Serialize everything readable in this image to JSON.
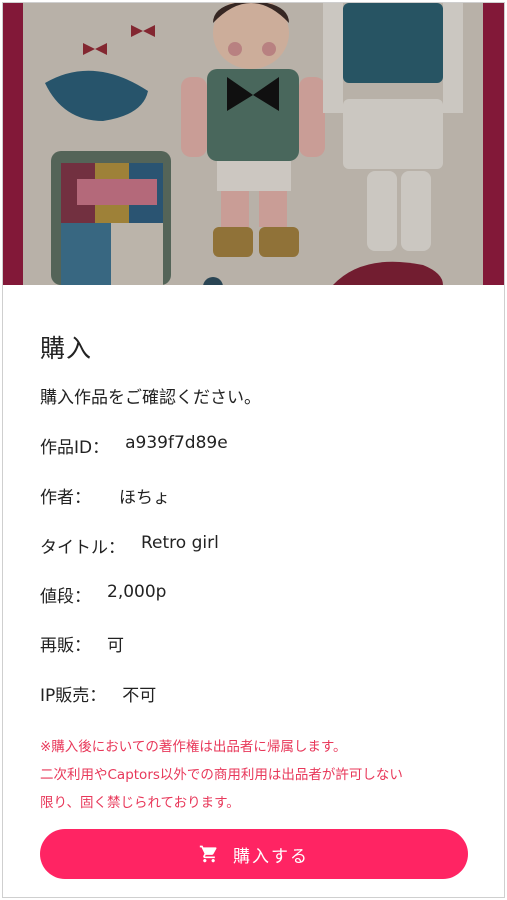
{
  "purchase": {
    "title": "購入",
    "intro": "購入作品をご確認ください。",
    "fields": [
      {
        "label": "作品ID：",
        "value": "a939f7d89e"
      },
      {
        "label": "作者：",
        "value": "ほちょ"
      },
      {
        "label": "タイトル：",
        "value": "Retro girl"
      },
      {
        "label": "値段：",
        "value": "2,000p"
      },
      {
        "label": "再販：",
        "value": "可"
      },
      {
        "label": "IP販売：",
        "value": "不可"
      }
    ],
    "notice": [
      "※購入後においての著作権は出品者に帰属します。",
      "二次利用やCaptors以外での商用利用は出品者が許可しない",
      "限り、固く禁じられております。"
    ],
    "button_label": "購入する",
    "button_icon": "cart-icon"
  },
  "colors": {
    "accent": "#ff2463",
    "notice": "#e8385a"
  }
}
